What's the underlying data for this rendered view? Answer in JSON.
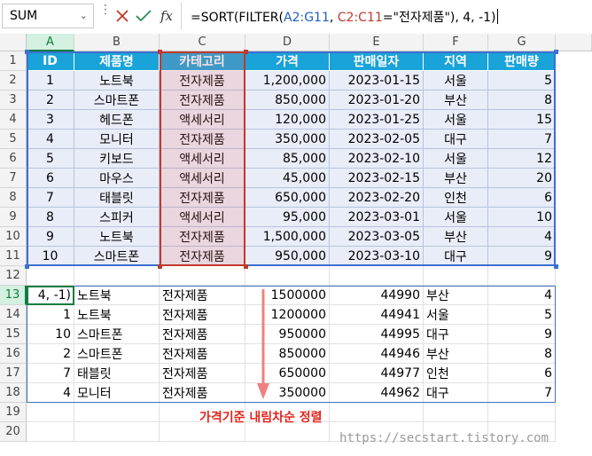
{
  "formula_bar": {
    "name_box": "SUM",
    "cancel_icon": "close-icon",
    "enter_icon": "check-icon",
    "function_label": "fx",
    "formula_parts": [
      "=SORT(FILTER(",
      "A2:G11",
      ", ",
      "C2:C11",
      "=\"전자제품\"), 4, -1)"
    ]
  },
  "columns": [
    "A",
    "B",
    "C",
    "D",
    "E",
    "F",
    "G"
  ],
  "rows": [
    "1",
    "2",
    "3",
    "4",
    "5",
    "6",
    "7",
    "8",
    "9",
    "10",
    "11",
    "12",
    "13",
    "14",
    "15",
    "16",
    "17",
    "18",
    "19",
    "20"
  ],
  "table": {
    "headers": [
      "ID",
      "제품명",
      "카테고리",
      "가격",
      "판매일자",
      "지역",
      "판매량"
    ],
    "rows": [
      [
        "1",
        "노트북",
        "전자제품",
        "1,200,000",
        "2023-01-15",
        "서울",
        "5"
      ],
      [
        "2",
        "스마트폰",
        "전자제품",
        "850,000",
        "2023-01-20",
        "부산",
        "8"
      ],
      [
        "3",
        "헤드폰",
        "액세서리",
        "120,000",
        "2023-01-25",
        "서울",
        "15"
      ],
      [
        "4",
        "모니터",
        "전자제품",
        "350,000",
        "2023-02-05",
        "대구",
        "7"
      ],
      [
        "5",
        "키보드",
        "액세서리",
        "85,000",
        "2023-02-10",
        "서울",
        "12"
      ],
      [
        "6",
        "마우스",
        "액세서리",
        "45,000",
        "2023-02-15",
        "부산",
        "20"
      ],
      [
        "7",
        "태블릿",
        "전자제품",
        "650,000",
        "2023-02-20",
        "인천",
        "6"
      ],
      [
        "8",
        "스피커",
        "액세서리",
        "95,000",
        "2023-03-01",
        "서울",
        "10"
      ],
      [
        "9",
        "노트북",
        "전자제품",
        "1,500,000",
        "2023-03-05",
        "부산",
        "4"
      ],
      [
        "10",
        "스마트폰",
        "전자제품",
        "950,000",
        "2023-03-10",
        "대구",
        "9"
      ]
    ]
  },
  "result": {
    "rows": [
      [
        "4, -1)",
        "노트북",
        "전자제품",
        "1500000",
        "44990",
        "부산",
        "4"
      ],
      [
        "1",
        "노트북",
        "전자제품",
        "1200000",
        "44941",
        "서울",
        "5"
      ],
      [
        "10",
        "스마트폰",
        "전자제품",
        "950000",
        "44995",
        "대구",
        "9"
      ],
      [
        "2",
        "스마트폰",
        "전자제품",
        "850000",
        "44946",
        "부산",
        "8"
      ],
      [
        "7",
        "태블릿",
        "전자제품",
        "650000",
        "44977",
        "인천",
        "6"
      ],
      [
        "4",
        "모니터",
        "전자제품",
        "350000",
        "44962",
        "대구",
        "7"
      ]
    ]
  },
  "annotation": {
    "callout": "가격기준 내림차순 정렬",
    "watermark": "https://secstart.tistory.com"
  },
  "colors": {
    "header_bg": "#1aa3d9",
    "table_band": "#e9edf7",
    "ref_blue": "#3c6fcf",
    "ref_red": "#c0392b",
    "callout": "#e0261c"
  }
}
